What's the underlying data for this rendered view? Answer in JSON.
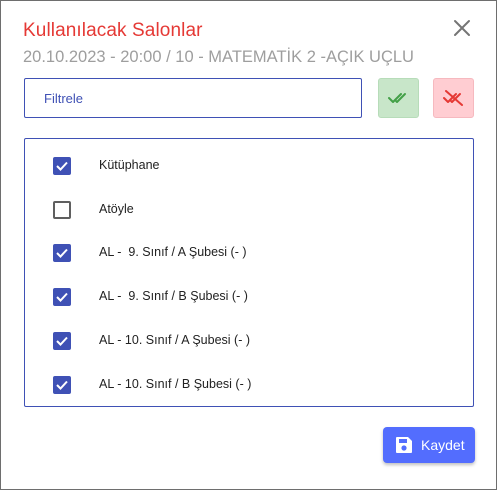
{
  "dialog": {
    "title": "Kullanılacak Salonlar",
    "subtitle": "20.10.2023 - 20:00 / 10 - MATEMATİK 2 -AÇIK UÇLU",
    "close_icon": "close-icon"
  },
  "filter": {
    "placeholder": "Filtrele",
    "value": ""
  },
  "actions": {
    "select_all_icon": "double-check-icon",
    "deselect_all_icon": "double-check-off-icon"
  },
  "rooms": [
    {
      "label": "Kütüphane",
      "checked": true
    },
    {
      "label": "Atöyle",
      "checked": false
    },
    {
      "label": "AL -  9. Sınıf / A Şubesi (- )",
      "checked": true
    },
    {
      "label": "AL -  9. Sınıf / B Şubesi (- )",
      "checked": true
    },
    {
      "label": "AL - 10. Sınıf / A Şubesi (- )",
      "checked": true
    },
    {
      "label": "AL - 10. Sınıf / B Şubesi (- )",
      "checked": true
    }
  ],
  "save_button": {
    "label": "Kaydet",
    "icon": "floppy-disk-icon"
  },
  "colors": {
    "title": "#e53935",
    "primary": "#3f51b5",
    "save_button": "#536dfe",
    "select_all_bg": "#c8e6c9",
    "deselect_all_bg": "#ffcdd2"
  }
}
